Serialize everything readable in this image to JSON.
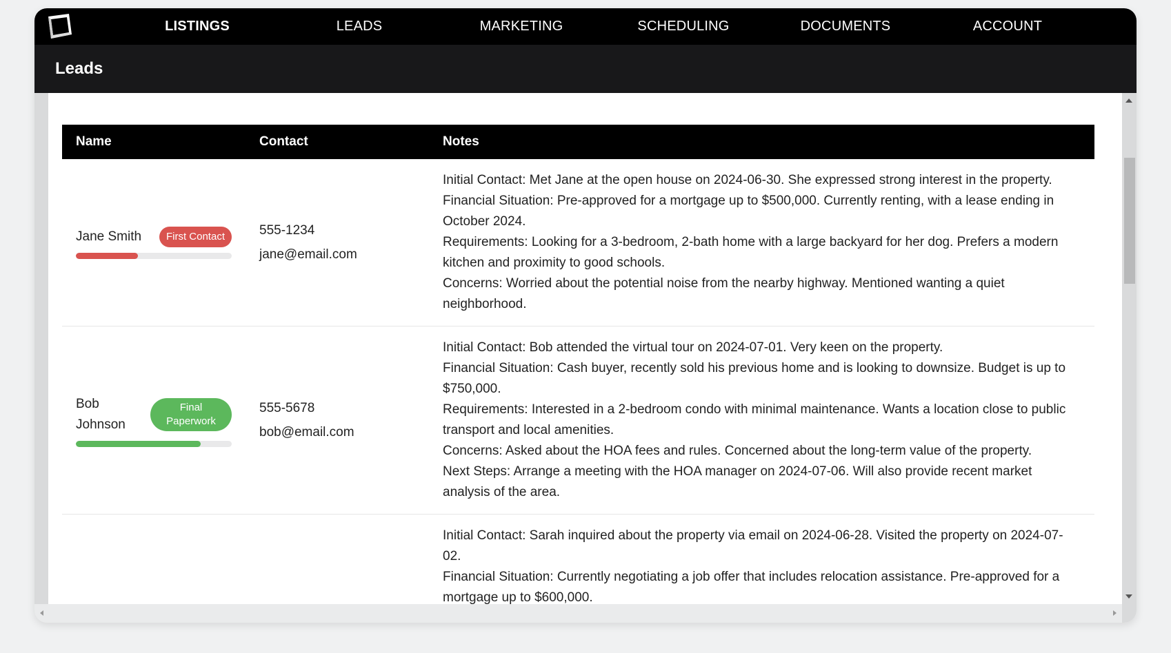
{
  "nav": {
    "items": [
      {
        "label": "LISTINGS",
        "active": true
      },
      {
        "label": "LEADS",
        "active": false
      },
      {
        "label": "MARKETING",
        "active": false
      },
      {
        "label": "SCHEDULING",
        "active": false
      },
      {
        "label": "DOCUMENTS",
        "active": false
      },
      {
        "label": "ACCOUNT",
        "active": false
      }
    ]
  },
  "page": {
    "title": "Leads"
  },
  "table": {
    "headers": {
      "name": "Name",
      "contact": "Contact",
      "notes": "Notes"
    },
    "rows": [
      {
        "name": "Jane Smith",
        "status": "First Contact",
        "status_color": "#d9534f",
        "progress": 0.4,
        "phone": "555-1234",
        "email": "jane@email.com",
        "notes": [
          "Initial Contact: Met Jane at the open house on 2024-06-30. She expressed strong interest in the property.",
          "Financial Situation: Pre-approved for a mortgage up to $500,000. Currently renting, with a lease ending in October 2024.",
          "Requirements: Looking for a 3-bedroom, 2-bath home with a large backyard for her dog. Prefers a modern kitchen and proximity to good schools.",
          "Concerns: Worried about the potential noise from the nearby highway. Mentioned wanting a quiet neighborhood."
        ]
      },
      {
        "name": "Bob Johnson",
        "status": "Final Paperwork",
        "status_color": "#5cb85c",
        "progress": 0.8,
        "phone": "555-5678",
        "email": "bob@email.com",
        "notes": [
          "Initial Contact: Bob attended the virtual tour on 2024-07-01. Very keen on the property.",
          "Financial Situation: Cash buyer, recently sold his previous home and is looking to downsize. Budget is up to $750,000.",
          "Requirements: Interested in a 2-bedroom condo with minimal maintenance. Wants a location close to public transport and local amenities.",
          "Concerns: Asked about the HOA fees and rules. Concerned about the long-term value of the property.",
          "Next Steps: Arrange a meeting with the HOA manager on 2024-07-06. Will also provide recent market analysis of the area."
        ]
      },
      {
        "name": "",
        "status": "",
        "status_color": "",
        "progress": null,
        "phone": "",
        "email": "",
        "notes": [
          "Initial Contact: Sarah inquired about the property via email on 2024-06-28. Visited the property on 2024-07-02.",
          "Financial Situation: Currently negotiating a job offer that includes relocation assistance. Pre-approved for a mortgage up to $600,000."
        ]
      }
    ]
  }
}
